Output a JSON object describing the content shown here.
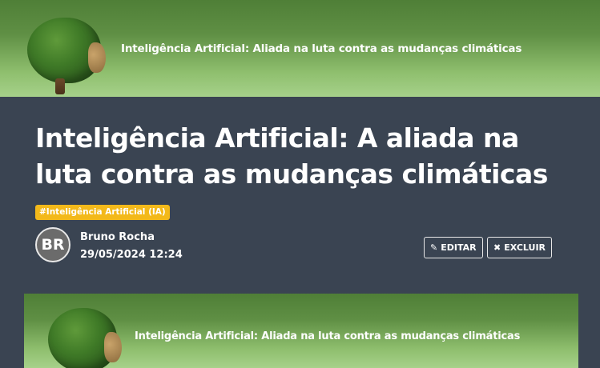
{
  "top_banner": {
    "title": "Inteligência Artificial: Aliada na luta contra as mudanças climáticas",
    "image_icon": "tree-brain-head-icon"
  },
  "article": {
    "title": "Inteligência Artificial: A aliada na luta contra as mudanças climáticas",
    "tag": "#Inteligência Artificial (IA)",
    "author": {
      "initials": "BR",
      "name": "Bruno Rocha",
      "datetime": "29/05/2024 12:24"
    },
    "actions": {
      "edit_label": "EDITAR",
      "edit_icon": "pencil-icon",
      "delete_label": "EXCLUIR",
      "delete_icon": "close-icon"
    }
  },
  "cover_banner": {
    "title": "Inteligência Artificial: Aliada na luta contra as mudanças climáticas",
    "image_icon": "tree-brain-head-icon"
  },
  "colors": {
    "page_background": "#3a4452",
    "banner_dark_green": "#4f7f37",
    "banner_light_green": "#a6d18a",
    "tag_background": "#f3b91a",
    "text": "#ffffff"
  }
}
